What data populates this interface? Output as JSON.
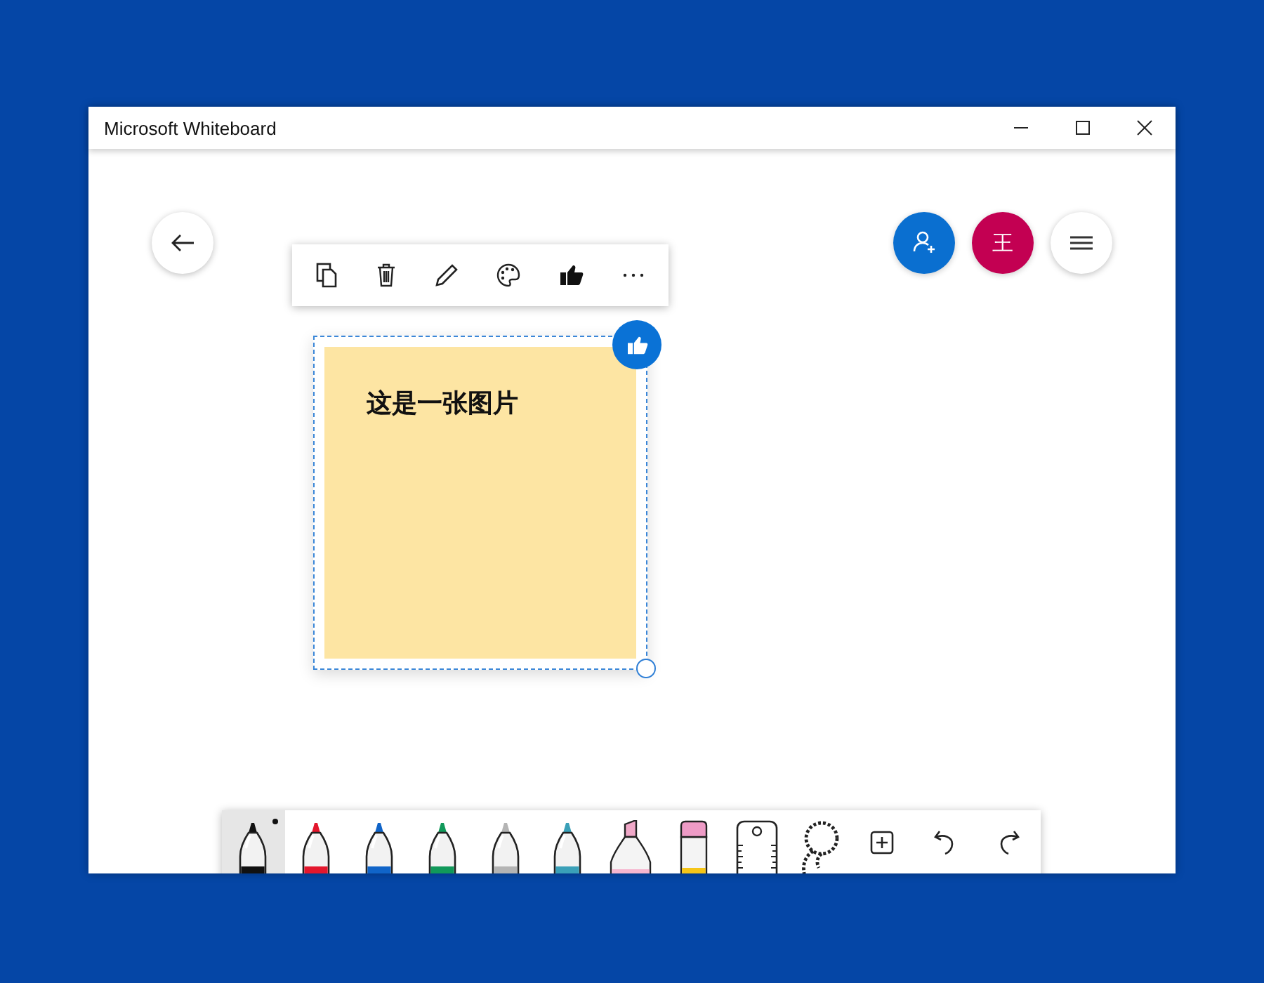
{
  "window": {
    "title": "Microsoft Whiteboard"
  },
  "avatar": {
    "initial": "王",
    "color": "#c30052"
  },
  "note": {
    "text": "这是一张图片",
    "selected": true,
    "liked": true
  },
  "pens": [
    {
      "color": "#111111",
      "selected": true
    },
    {
      "color": "#e3172d",
      "selected": false
    },
    {
      "color": "#1064c8",
      "selected": false
    },
    {
      "color": "#11995a",
      "selected": false
    },
    {
      "color": "#b4b4b4",
      "selected": false
    },
    {
      "color": "#3aa0b8",
      "selected": false
    }
  ]
}
